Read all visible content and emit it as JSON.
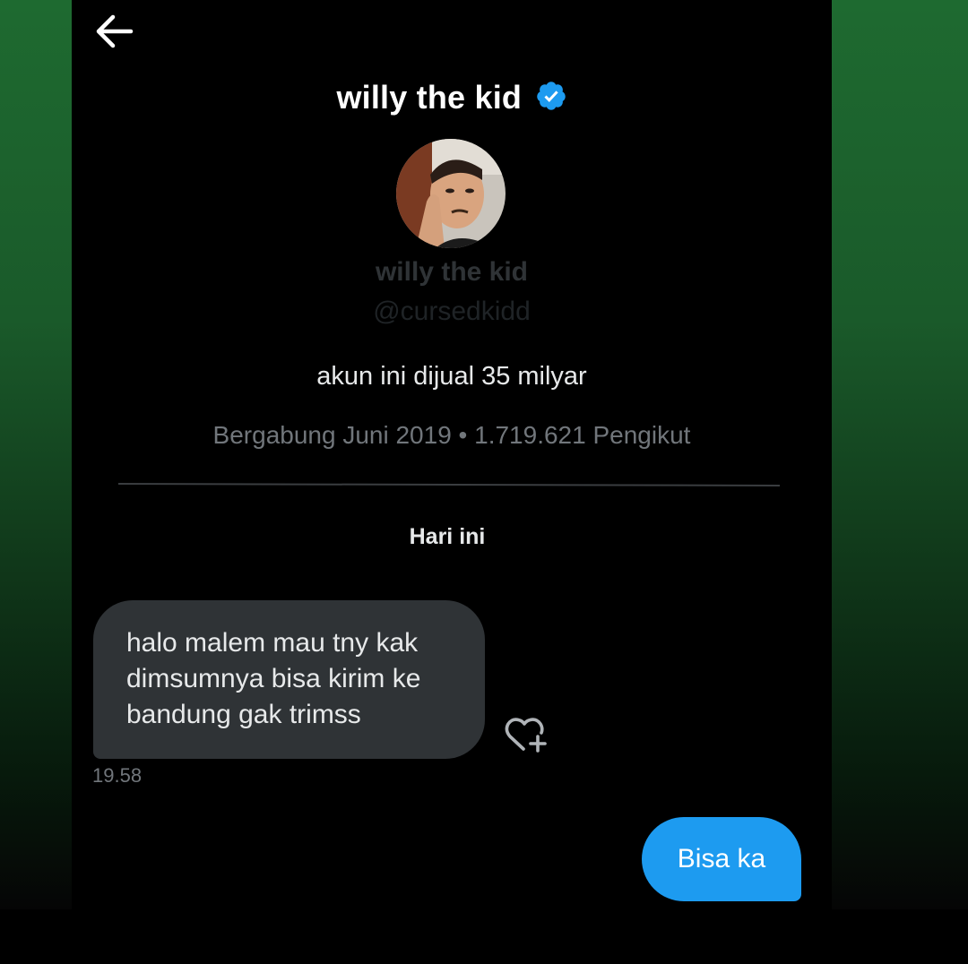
{
  "header": {
    "back_icon": "arrow-left-icon",
    "title": "willy the kid",
    "verified_icon": "verified-badge-icon"
  },
  "profile": {
    "name": "willy the kid",
    "handle": "@cursedkidd",
    "bio": "akun ini dijual 35 milyar",
    "meta": "Bergabung Juni 2019 • 1.719.621 Pengikut"
  },
  "conversation": {
    "day_label": "Hari ini",
    "messages": [
      {
        "direction": "incoming",
        "lines": [
          "halo malem mau tny kak",
          "dimsumnya bisa kirim ke",
          "bandung gak trimss"
        ],
        "time": "19.58",
        "reaction_icon": "heart-plus-icon"
      },
      {
        "direction": "outgoing",
        "text": "Bisa ka"
      }
    ]
  },
  "colors": {
    "accent": "#1d9bf0",
    "incoming_bubble": "#2f3336",
    "background": "#000000",
    "muted_text": "#71767b",
    "outer_gradient_top": "#1e6a30"
  }
}
